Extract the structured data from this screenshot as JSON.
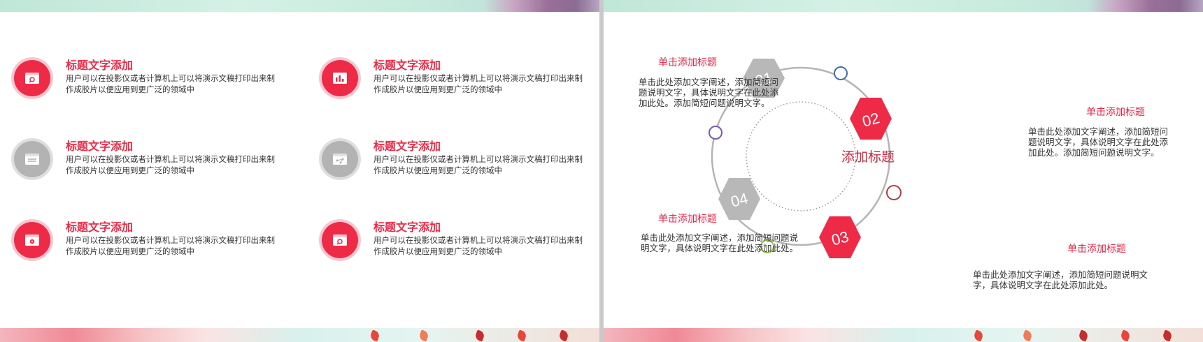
{
  "left_slide": {
    "items": [
      {
        "title": "标题文字添加",
        "desc": "用户可以在投影仪或者计算机上可以将演示文稿打印出来制作成胶片以便应用到更广泛的领域中",
        "icon": "browser-search-icon",
        "color": "#ee2a47"
      },
      {
        "title": "标题文字添加",
        "desc": "用户可以在投影仪或者计算机上可以将演示文稿打印出来制作成胶片以便应用到更广泛的领域中",
        "icon": "browser-chart-icon",
        "color": "#ee2a47"
      },
      {
        "title": "标题文字添加",
        "desc": "用户可以在投影仪或者计算机上可以将演示文稿打印出来制作成胶片以便应用到更广泛的领域中",
        "icon": "browser-list-icon",
        "color": "#b3b3b3"
      },
      {
        "title": "标题文字添加",
        "desc": "用户可以在投影仪或者计算机上可以将演示文稿打印出来制作成胶片以便应用到更广泛的领域中",
        "icon": "browser-network-icon",
        "color": "#b3b3b3"
      },
      {
        "title": "标题文字添加",
        "desc": "用户可以在投影仪或者计算机上可以将演示文稿打印出来制作成胶片以便应用到更广泛的领域中",
        "icon": "browser-settings-icon",
        "color": "#ee2a47"
      },
      {
        "title": "标题文字添加",
        "desc": "用户可以在投影仪或者计算机上可以将演示文稿打印出来制作成胶片以便应用到更广泛的领域中",
        "icon": "browser-search-icon",
        "color": "#ee2a47"
      }
    ]
  },
  "right_slide": {
    "center_title": "添加标题",
    "hexagons": [
      {
        "number": "01",
        "color": "#b8b8b8"
      },
      {
        "number": "02",
        "color": "#ee2a47"
      },
      {
        "number": "03",
        "color": "#ee2a47"
      },
      {
        "number": "04",
        "color": "#b8b8b8"
      }
    ],
    "blocks": [
      {
        "title": "单击添加标题",
        "desc": "单击此处添加文字阐述，添加简短问题说明文字，具体说明文字在此处添加此处。添加简短问题说明文字。"
      },
      {
        "title": "单击添加标题",
        "desc": "单击此处添加文字阐述，添加简短问题说明文字，具体说明文字在此处添加此处。添加简短问题说明文字。"
      },
      {
        "title": "单击添加标题",
        "desc": "单击此处添加文字阐述，添加简短问题说明文字，具体说明文字在此处添加此处。"
      },
      {
        "title": "单击添加标题",
        "desc": "单击此处添加文字阐述，添加简短问题说明文字，具体说明文字在此处添加此处。"
      }
    ],
    "dot_colors": [
      "#3f6fb0",
      "#b23a48",
      "#97c24a",
      "#7a5aa6"
    ]
  }
}
